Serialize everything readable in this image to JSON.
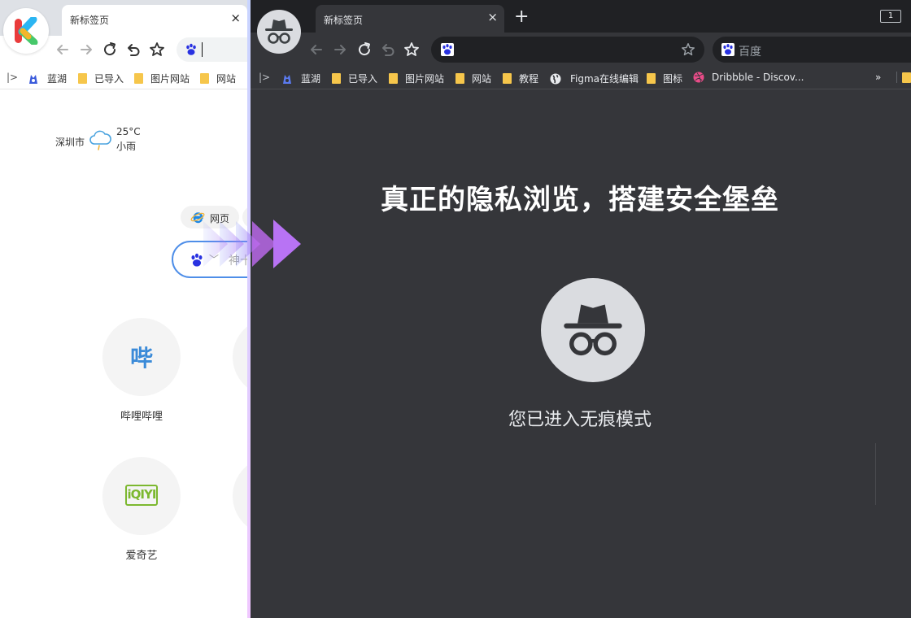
{
  "normal_window": {
    "tab": {
      "title": "新标签页",
      "close": "×"
    },
    "bookmarks": [
      "蓝湖",
      "已导入",
      "图片网站",
      "网站"
    ],
    "weather": {
      "city": "深圳市",
      "temperature": "25°C",
      "condition": "小雨"
    },
    "search_chip": "网页",
    "search_placeholder": "神十",
    "apps": [
      {
        "label": "哔哩哔哩",
        "glyph": "哔"
      },
      {
        "label": "爱奇艺",
        "glyph": "iQIYI"
      }
    ]
  },
  "incognito_window": {
    "tab": {
      "title": "新标签页",
      "close": "×"
    },
    "new_tab": "+",
    "window_count": "1",
    "search_box": "百度",
    "bookmarks": [
      "蓝湖",
      "已导入",
      "图片网站",
      "网站",
      "教程",
      "Figma在线编辑",
      "图标",
      "Dribbble - Discov..."
    ],
    "bookmarks_overflow": "»",
    "headline": "真正的隐私浏览，搭建安全堡垒",
    "subtitle": "您已进入无痕模式"
  },
  "colors": {
    "incognito_bg": "#35363a",
    "incognito_frame": "#202124",
    "search_border": "#4e8ee8",
    "bilibili": "#3a8ad8",
    "iqiyi": "#7cb82f",
    "arrow_start": "#7b8cf7",
    "arrow_end": "#c16cf2"
  }
}
